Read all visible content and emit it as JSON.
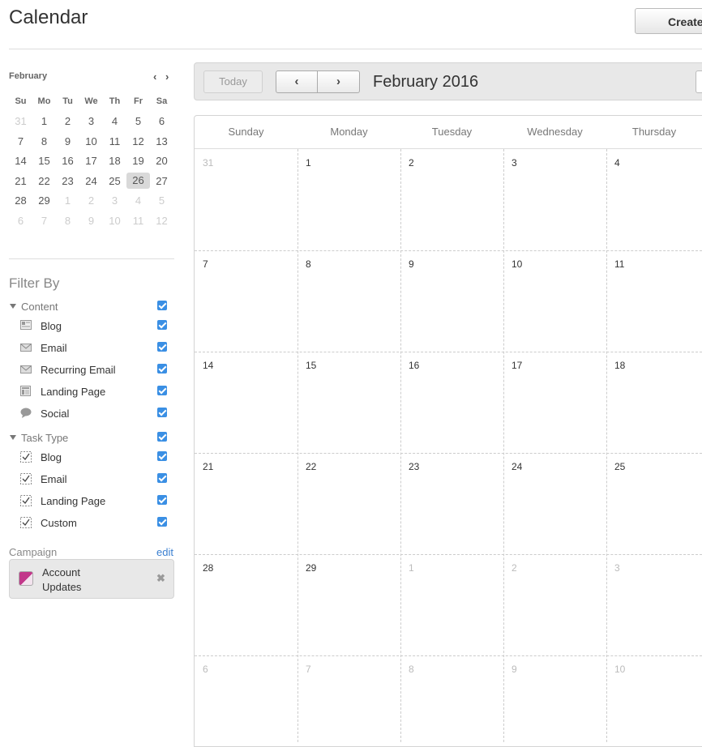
{
  "header": {
    "title": "Calendar",
    "create_label": "Create"
  },
  "mini": {
    "month": "February",
    "prev": "‹",
    "next": "›",
    "days_of_week": [
      "Su",
      "Mo",
      "Tu",
      "We",
      "Th",
      "Fr",
      "Sa"
    ],
    "weeks": [
      [
        "31",
        "1",
        "2",
        "3",
        "4",
        "5",
        "6"
      ],
      [
        "7",
        "8",
        "9",
        "10",
        "11",
        "12",
        "13"
      ],
      [
        "14",
        "15",
        "16",
        "17",
        "18",
        "19",
        "20"
      ],
      [
        "21",
        "22",
        "23",
        "24",
        "25",
        "26",
        "27"
      ],
      [
        "28",
        "29",
        "1",
        "2",
        "3",
        "4",
        "5"
      ],
      [
        "6",
        "7",
        "8",
        "9",
        "10",
        "11",
        "12"
      ]
    ],
    "selected": "26"
  },
  "filter": {
    "title": "Filter By",
    "content": {
      "label": "Content",
      "items": [
        "Blog",
        "Email",
        "Recurring Email",
        "Landing Page",
        "Social"
      ]
    },
    "task_type": {
      "label": "Task Type",
      "items": [
        "Blog",
        "Email",
        "Landing Page",
        "Custom"
      ]
    }
  },
  "campaign": {
    "label": "Campaign",
    "edit": "edit",
    "name": "Account Updates",
    "close": "✖"
  },
  "toolbar": {
    "today": "Today",
    "prev": "‹",
    "next": "›",
    "title": "February 2016"
  },
  "calendar": {
    "headers": [
      "Sunday",
      "Monday",
      "Tuesday",
      "Wednesday",
      "Thursday"
    ],
    "weeks": [
      [
        "31",
        "1",
        "2",
        "3",
        "4"
      ],
      [
        "7",
        "8",
        "9",
        "10",
        "11"
      ],
      [
        "14",
        "15",
        "16",
        "17",
        "18"
      ],
      [
        "21",
        "22",
        "23",
        "24",
        "25"
      ],
      [
        "28",
        "29",
        "1",
        "2",
        "3"
      ],
      [
        "6",
        "7",
        "8",
        "9",
        "10"
      ]
    ]
  },
  "colors": {
    "accent": "#3a8fe4",
    "campaign": "#c2378a"
  }
}
